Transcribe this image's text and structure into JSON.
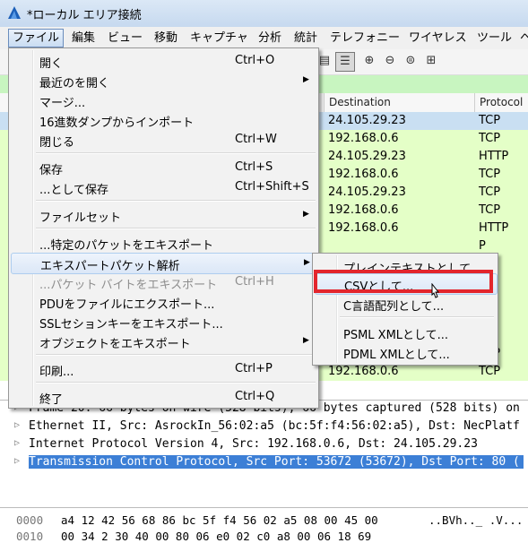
{
  "window": {
    "title": "*ローカル エリア接続"
  },
  "menubar": [
    "ファイル",
    "編集",
    "ビュー",
    "移動",
    "キャプチャ",
    "分析",
    "統計",
    "テレフォニー",
    "ワイヤレス",
    "ツール",
    "ヘ"
  ],
  "packet_list": {
    "headers": {
      "destination": "Destination",
      "protocol": "Protocol"
    },
    "rows": [
      {
        "dst": "24.105.29.23",
        "proto": "TCP",
        "bg": "#c9dff2"
      },
      {
        "dst": "192.168.0.6",
        "proto": "TCP",
        "bg": "#e4ffc7"
      },
      {
        "dst": "24.105.29.23",
        "proto": "HTTP",
        "bg": "#e4ffc7"
      },
      {
        "dst": "192.168.0.6",
        "proto": "TCP",
        "bg": "#e4ffc7"
      },
      {
        "dst": "24.105.29.23",
        "proto": "TCP",
        "bg": "#e4ffc7"
      },
      {
        "dst": "192.168.0.6",
        "proto": "TCP",
        "bg": "#e4ffc7"
      },
      {
        "dst": "192.168.0.6",
        "proto": "HTTP",
        "bg": "#e4ffc7"
      },
      {
        "dst": "",
        "proto": "P",
        "bg": "#e4ffc7"
      },
      {
        "dst": "",
        "proto": "P",
        "bg": "#e4ffc7"
      },
      {
        "dst": "",
        "proto": "P",
        "bg": "#e4ffc7"
      },
      {
        "dst": "",
        "proto": "P",
        "bg": "#e4ffc7"
      },
      {
        "dst": "",
        "proto": "TP",
        "bg": "#e4ffc7"
      },
      {
        "dst": "",
        "proto": "P",
        "bg": "#e4ffc7"
      },
      {
        "dst": "192.168.0.6",
        "proto": "TCP",
        "bg": "#e4ffc7"
      },
      {
        "dst": "192.168.0.6",
        "proto": "TCP",
        "bg": "#e4ffc7"
      }
    ]
  },
  "file_menu": {
    "items": [
      {
        "label": "開く",
        "shortcut": "Ctrl+O"
      },
      {
        "label": "最近のを開く",
        "submenu": true
      },
      {
        "label": "マージ..."
      },
      {
        "label": "16進数ダンプからインポート"
      },
      {
        "label": "閉じる",
        "shortcut": "Ctrl+W"
      },
      {
        "label": "保存",
        "shortcut": "Ctrl+S"
      },
      {
        "label": "...として保存",
        "shortcut": "Ctrl+Shift+S"
      },
      {
        "label": "ファイルセット",
        "submenu": true
      },
      {
        "label": "...特定のパケットをエキスポート"
      },
      {
        "label": "エキスパートパケット解析",
        "submenu": true,
        "hot": true
      },
      {
        "label": "...パケット バイトをエキスポート",
        "shortcut": "Ctrl+H",
        "disabled": true
      },
      {
        "label": "PDUをファイルにエクスポート..."
      },
      {
        "label": "SSLセションキーをエキスポート..."
      },
      {
        "label": "オブジェクトをエキスポート",
        "submenu": true
      },
      {
        "label": "印刷...",
        "shortcut": "Ctrl+P"
      },
      {
        "label": "終了",
        "shortcut": "Ctrl+Q"
      }
    ]
  },
  "export_submenu": {
    "items": [
      {
        "label": "プレインテキストとして..."
      },
      {
        "label": "CSVとして...",
        "hot": true
      },
      {
        "label": "C言語配列として..."
      },
      {
        "label": "PSML XMLとして..."
      },
      {
        "label": "PDML XMLとして..."
      }
    ]
  },
  "details": {
    "rows": [
      {
        "text": "Frame 20: 66 bytes on wire (528 bits), 66 bytes captured (528 bits) on"
      },
      {
        "text": "Ethernet II, Src: AsrockIn_56:02:a5 (bc:5f:f4:56:02:a5), Dst: NecPlatf"
      },
      {
        "text": "Internet Protocol Version 4, Src: 192.168.0.6, Dst: 24.105.29.23"
      },
      {
        "text": "Transmission Control Protocol, Src Port: 53672 (53672), Dst Port: 80 ("
      }
    ]
  },
  "hex": {
    "offset": "0000",
    "bytes": "a4 12 42 56 68 86 bc 5f  f4 56 02 a5 08 00 45 00",
    "ascii": "..BVh.._ .V...",
    "offset2": "0010",
    "bytes2": "00 34 2  30 40 00 80 06  e0 02 c0 a8 00 06 18 69"
  },
  "colors": {
    "highlight": "#e3262d",
    "selection": "#3c7fd6",
    "filter_ok": "#c8f5c0"
  }
}
